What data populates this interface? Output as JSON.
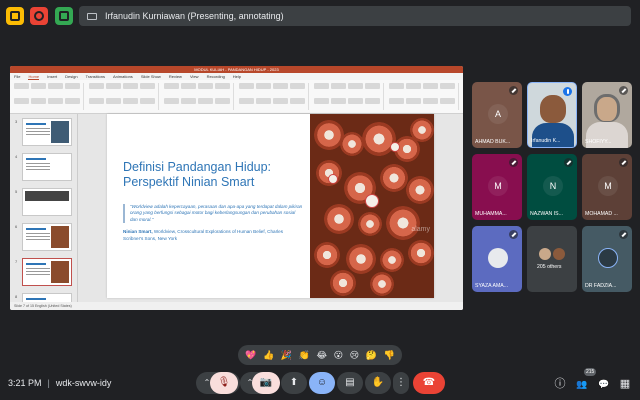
{
  "topbar": {
    "presenting_label": "Irfanudin Kurniawan (Presenting, annotating)"
  },
  "ppt": {
    "window_title": "MODUL KULIAH - PANDANGAN HIDUP - 2023",
    "menu": [
      "File",
      "Home",
      "Insert",
      "Design",
      "Transitions",
      "Animations",
      "Slide Show",
      "Review",
      "View",
      "Recording",
      "Help"
    ],
    "active_menu": "Home",
    "thumbs": [
      "3",
      "4",
      "5",
      "6",
      "7",
      "8"
    ],
    "status": "Slide 7 of 15    English (United States)",
    "slide": {
      "title": "Definisi Pandangan Hidup: Perspektif Ninian Smart",
      "quote": "\"Worldview adalah kepercayaan, perasaan dan apa-apa yang terdapat dalam pikiran orang yang berfungsi sebagai motor bagi keberlangsungan dan perubahan sosial dan moral.\"",
      "cite_author": "Ninian Smart,",
      "cite_rest": "Worldview, Crosscultural Explorations of Human Belief, Charles Scribner's Sons, New York",
      "watermark": "alamy"
    }
  },
  "participants": [
    {
      "name": "AHMAD BUK...",
      "initial": "A",
      "color": "#795548"
    },
    {
      "name": "Irfanudin K...",
      "initial": "",
      "color": "#9e9e9e"
    },
    {
      "name": "SHOFIYY...",
      "initial": "",
      "color": "#9e9e9e"
    },
    {
      "name": "MUHAMMA...",
      "initial": "M",
      "color": "#880e4f"
    },
    {
      "name": "NAZWAN IS...",
      "initial": "N",
      "color": "#004d40"
    },
    {
      "name": "MOHAMAD ...",
      "initial": "M",
      "color": "#5d4037"
    },
    {
      "name": "SYAZA AMA...",
      "initial": "",
      "color": "#5c6bc0"
    },
    {
      "name": "205 others",
      "initial": "",
      "color": "#3c4043"
    },
    {
      "name": "DR FADZIA...",
      "initial": "",
      "color": "#455a64"
    }
  ],
  "reactions": [
    "💖",
    "👍",
    "🎉",
    "👏",
    "😂",
    "😮",
    "😢",
    "🤔",
    "👎"
  ],
  "bottombar": {
    "time": "3:21 PM",
    "separator": "|",
    "meeting_code": "wdk-swvw-idy",
    "participant_count": "215"
  },
  "icons": {
    "mic_off": "🎙",
    "cam_off": "📷",
    "present": "⬆",
    "emoji": "☺",
    "captions": "▤",
    "hand": "✋",
    "more": "⋮",
    "end_call": "☎",
    "info": "ⓘ",
    "people": "👥",
    "chat": "💬",
    "activities": "▦",
    "chevron": "⌃"
  }
}
